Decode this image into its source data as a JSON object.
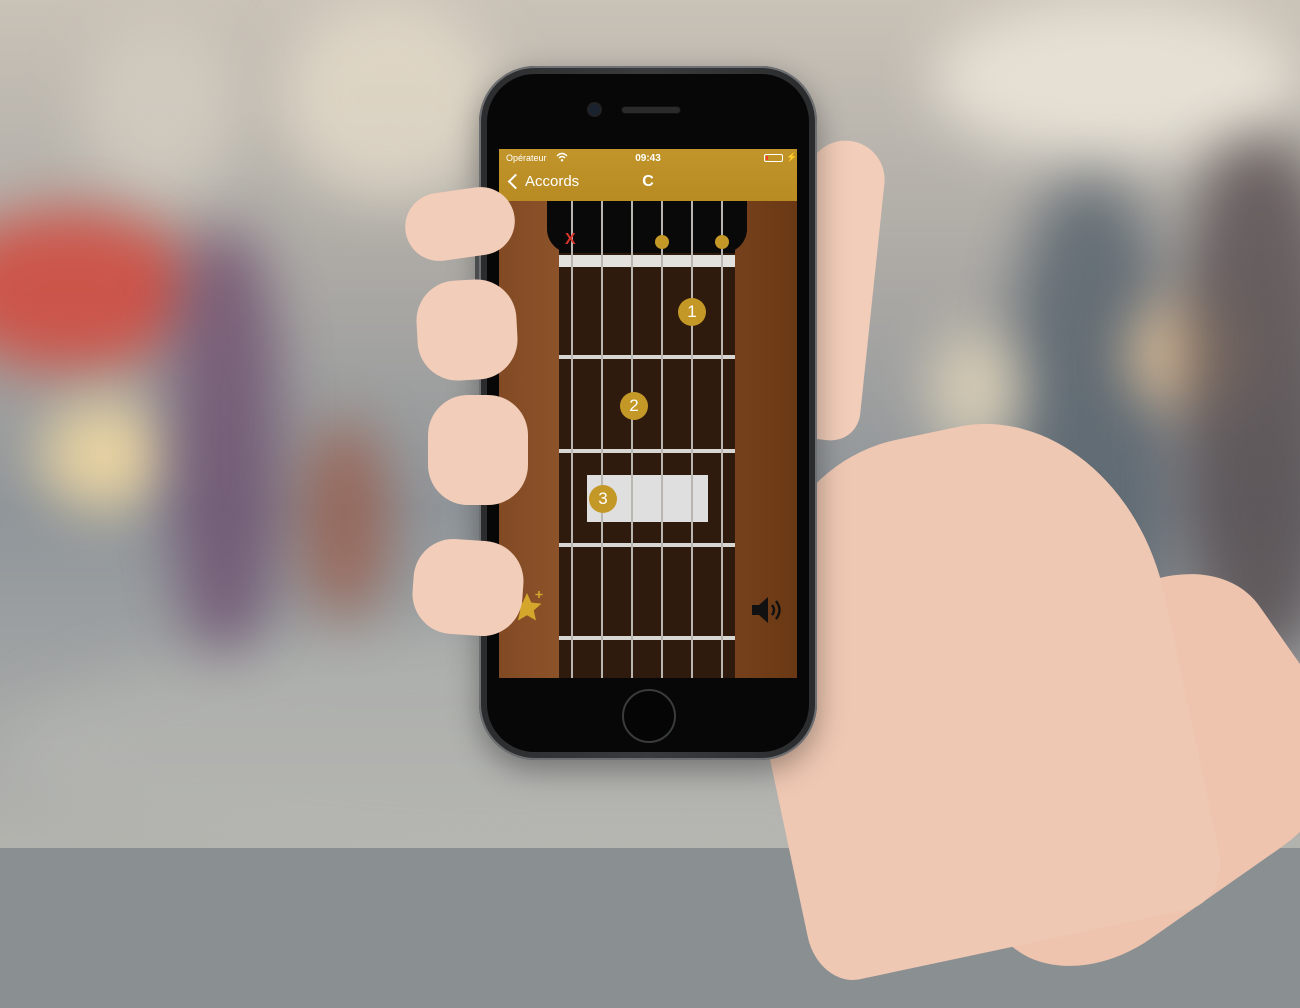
{
  "status_bar": {
    "carrier": "Opérateur",
    "time": "09:43"
  },
  "nav": {
    "back_label": "Accords",
    "title": "C"
  },
  "chord": {
    "muted_string_marker": "X",
    "fingers": [
      {
        "label": "1"
      },
      {
        "label": "2"
      },
      {
        "label": "3"
      }
    ]
  },
  "icons": {
    "favorite": "star-plus-icon",
    "sound": "speaker-icon",
    "wifi": "wifi-icon",
    "battery": "battery-icon",
    "back": "chevron-left-icon"
  },
  "colors": {
    "accent": "#C1952A",
    "fretboard": "#2F1B0E",
    "wood": "#8C532A",
    "muted": "#D8352A"
  }
}
